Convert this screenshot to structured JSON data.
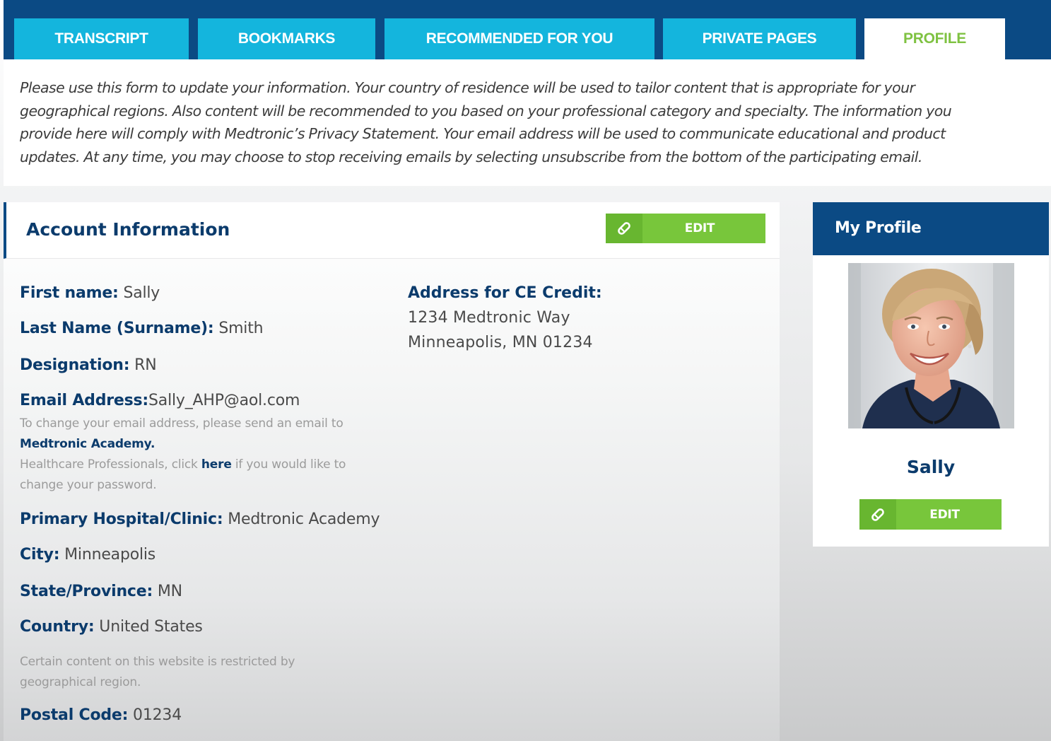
{
  "tabs": [
    {
      "label": "TRANSCRIPT"
    },
    {
      "label": "BOOKMARKS"
    },
    {
      "label": "RECOMMENDED FOR YOU"
    },
    {
      "label": "PRIVATE PAGES"
    },
    {
      "label": "PROFILE",
      "active": true
    }
  ],
  "intro": "Please use this form to update your information. Your country of residence will be used to tailor content that is appropriate for your geographical regions. Also content will be recommended to you based on your professional category and specialty. The information you provide here will comply with Medtronic’s Privacy Statement. Your email address will be used to communicate educational and product updates. At any time, you may choose to stop receiving emails by selecting unsubscribe from the bottom of the participating email.",
  "account": {
    "title": "Account Information",
    "edit_label": "EDIT",
    "first_name": {
      "label": "First name:",
      "value": "Sally"
    },
    "last_name": {
      "label": "Last Name (Surname):",
      "value": "Smith"
    },
    "designation": {
      "label": "Designation:",
      "value": "RN"
    },
    "email": {
      "label": "Email Address:",
      "value": "Sally_AHP@aol.com"
    },
    "email_note_1": "To change your email address, please send an email to",
    "email_note_link": "Medtronic Academy.",
    "password_note_prefix": "Healthcare Professionals, click",
    "password_note_link": "here",
    "password_note_suffix": "if you would like to",
    "password_note_2": "change your password.",
    "hospital": {
      "label": "Primary Hospital/Clinic:",
      "value": "Medtronic Academy"
    },
    "city": {
      "label": "City:",
      "value": "Minneapolis"
    },
    "state": {
      "label": "State/Province:",
      "value": "MN"
    },
    "country": {
      "label": "Country:",
      "value": "United States"
    },
    "country_note_1": "Certain content on this website is restricted by",
    "country_note_2": "geographical region.",
    "postal": {
      "label": "Postal Code:",
      "value": "01234"
    },
    "address_label": "Address for CE Credit:",
    "address_line_1": "1234 Medtronic Way",
    "address_line_2": "Minneapolis, MN 01234"
  },
  "profile": {
    "title": "My Profile",
    "name": "Sally",
    "edit_label": "EDIT"
  },
  "colors": {
    "navy": "#0b4a84",
    "tab_cyan": "#14b5dd",
    "active_tab_text": "#7fc242",
    "edit_green": "#78c63b"
  }
}
